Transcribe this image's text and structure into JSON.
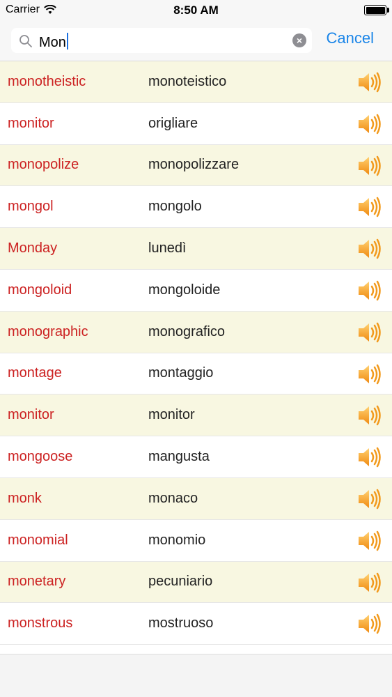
{
  "status": {
    "carrier": "Carrier",
    "time": "8:50 AM"
  },
  "search": {
    "value": "Mon",
    "placeholder": "Search",
    "cancel_label": "Cancel"
  },
  "colors": {
    "english": "#cc2222",
    "italian": "#222222",
    "accent": "#1a85e8",
    "alt_row": "#f8f7e1",
    "speaker": "#f29a1c"
  },
  "entries": [
    {
      "en": "monotheistic",
      "it": "monoteistico"
    },
    {
      "en": "monitor",
      "it": "origliare"
    },
    {
      "en": "monopolize",
      "it": "monopolizzare"
    },
    {
      "en": "mongol",
      "it": "mongolo"
    },
    {
      "en": "Monday",
      "it": "lunedì"
    },
    {
      "en": "mongoloid",
      "it": "mongoloide"
    },
    {
      "en": "monographic",
      "it": "monografico"
    },
    {
      "en": "montage",
      "it": "montaggio"
    },
    {
      "en": "monitor",
      "it": "monitor"
    },
    {
      "en": "mongoose",
      "it": "mangusta"
    },
    {
      "en": "monk",
      "it": "monaco"
    },
    {
      "en": "monomial",
      "it": "monomio"
    },
    {
      "en": "monetary",
      "it": "pecuniario"
    },
    {
      "en": "monstrous",
      "it": "mostruoso"
    }
  ]
}
